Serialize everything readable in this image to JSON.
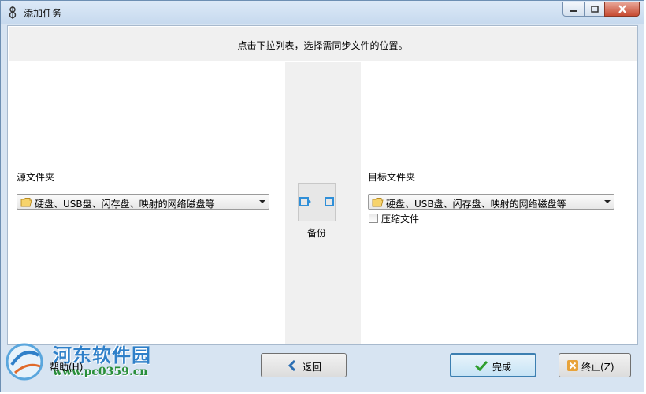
{
  "window": {
    "title": "添加任务"
  },
  "header": {
    "instruction": "点击下拉列表，选择需同步文件的位置。"
  },
  "source": {
    "label": "源文件夹",
    "dropdown_value": "硬盘、USB盘、闪存盘、映射的网络磁盘等"
  },
  "sync": {
    "mode_label": "备份"
  },
  "target": {
    "label": "目标文件夹",
    "dropdown_value": "硬盘、USB盘、闪存盘、映射的网络磁盘等",
    "compress_label": "压缩文件",
    "compress_checked": false
  },
  "footer": {
    "help_label": "帮助(H)",
    "back_label": "返回",
    "finish_label": "完成",
    "cancel_label": "终止(Z)"
  },
  "watermark": {
    "title": "河东软件园",
    "url": "www.pc0359.cn"
  },
  "colors": {
    "accent": "#3c7fb1",
    "sync_icon": "#2f8fd8",
    "finish_check": "#2e9e2e",
    "cancel_icon": "#e8a33a"
  }
}
